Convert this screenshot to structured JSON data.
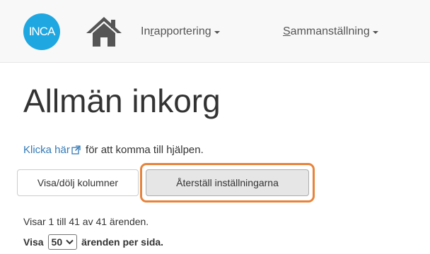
{
  "nav": {
    "logo_text": "INCA",
    "links": [
      {
        "before": "In",
        "underlined": "r",
        "after": "apportering"
      },
      {
        "before": "",
        "underlined": "S",
        "after": "ammanställning"
      }
    ]
  },
  "page": {
    "title": "Allmän inkorg",
    "help": {
      "link_text": "Klicka här",
      "rest": " för att komma till hjälpen."
    },
    "buttons": {
      "toggle_columns": "Visa/dölj kolumner",
      "reset_settings": "Återställ inställningarna"
    },
    "info_text": "Visar 1 till 41 av 41 ärenden.",
    "per_page": {
      "prefix": "Visa",
      "selected": "50",
      "suffix": "ärenden per sida."
    }
  },
  "colors": {
    "brand": "#1fa7e1",
    "link": "#337ab7",
    "highlight": "#e8833a"
  },
  "icons": [
    "home-icon",
    "external-link-icon",
    "caret-down-icon",
    "chevron-down-icon"
  ]
}
